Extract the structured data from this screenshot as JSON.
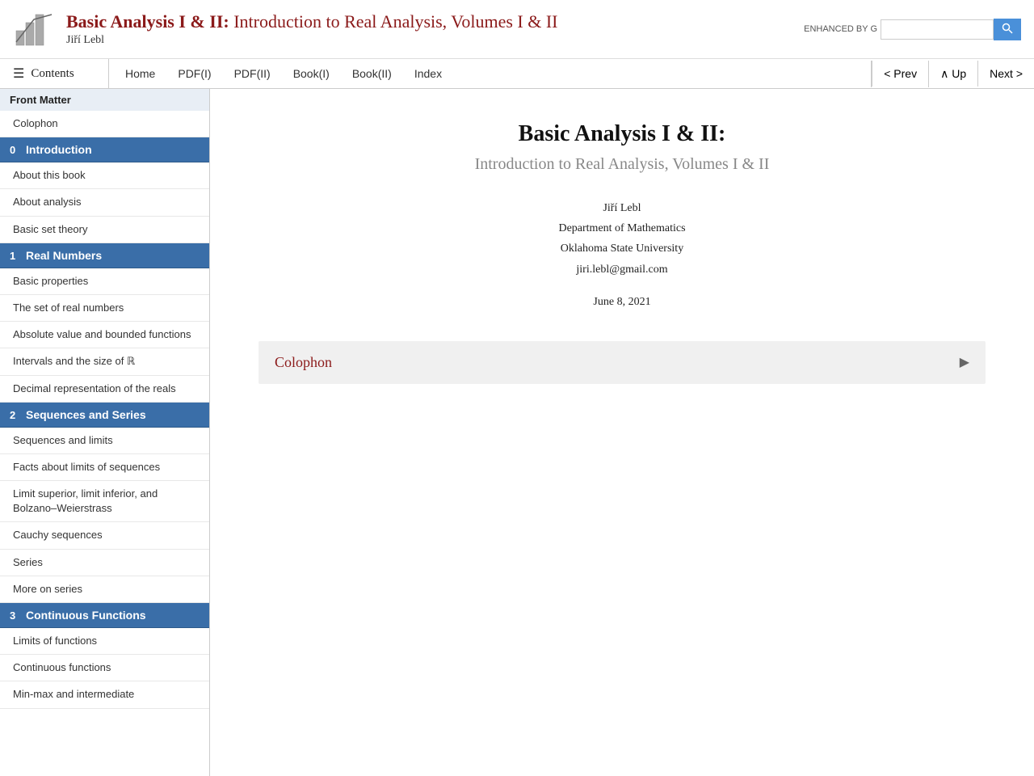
{
  "header": {
    "title_bold": "Basic Analysis I & II:",
    "title_regular": " Introduction to Real Analysis, Volumes I & II",
    "author": "Jiří Lebl",
    "search_label": "ENHANCED BY G",
    "search_placeholder": ""
  },
  "navbar": {
    "contents_label": "Contents",
    "links": [
      {
        "label": "Home",
        "href": "#"
      },
      {
        "label": "PDF(I)",
        "href": "#"
      },
      {
        "label": "PDF(II)",
        "href": "#"
      },
      {
        "label": "Book(I)",
        "href": "#"
      },
      {
        "label": "Book(II)",
        "href": "#"
      },
      {
        "label": "Index",
        "href": "#"
      }
    ],
    "prev_label": "< Prev",
    "up_label": "∧ Up",
    "next_label": "Next >"
  },
  "sidebar": {
    "front_matter_label": "Front Matter",
    "items": [
      {
        "label": "Colophon",
        "type": "item",
        "active": false
      },
      {
        "label": "Introduction",
        "type": "chapter",
        "num": "0",
        "active": true
      },
      {
        "label": "About this book",
        "type": "item",
        "active": false
      },
      {
        "label": "About analysis",
        "type": "item",
        "active": false
      },
      {
        "label": "Basic set theory",
        "type": "item",
        "active": false
      },
      {
        "label": "Real Numbers",
        "type": "chapter",
        "num": "1",
        "active": false
      },
      {
        "label": "Basic properties",
        "type": "item",
        "active": false
      },
      {
        "label": "The set of real numbers",
        "type": "item",
        "active": false
      },
      {
        "label": "Absolute value and bounded functions",
        "type": "item",
        "active": false
      },
      {
        "label": "Intervals and the size of ℝ",
        "type": "item",
        "active": false
      },
      {
        "label": "Decimal representation of the reals",
        "type": "item",
        "active": false
      },
      {
        "label": "Sequences and Series",
        "type": "chapter",
        "num": "2",
        "active": false
      },
      {
        "label": "Sequences and limits",
        "type": "item",
        "active": false
      },
      {
        "label": "Facts about limits of sequences",
        "type": "item",
        "active": false
      },
      {
        "label": "Limit superior, limit inferior, and Bolzano–Weierstrass",
        "type": "item",
        "active": false
      },
      {
        "label": "Cauchy sequences",
        "type": "item",
        "active": false
      },
      {
        "label": "Series",
        "type": "item",
        "active": false
      },
      {
        "label": "More on series",
        "type": "item",
        "active": false
      },
      {
        "label": "Continuous Functions",
        "type": "chapter",
        "num": "3",
        "active": false
      },
      {
        "label": "Limits of functions",
        "type": "item",
        "active": false
      },
      {
        "label": "Continuous functions",
        "type": "item",
        "active": false
      },
      {
        "label": "Min-max and intermediate",
        "type": "item",
        "active": false
      }
    ]
  },
  "main": {
    "book_title": "Basic Analysis I & II:",
    "book_subtitle": "Introduction to Real Analysis, Volumes I & II",
    "author_name": "Jiří Lebl",
    "department": "Department of Mathematics",
    "university": "Oklahoma State University",
    "email": "jiri.lebl@gmail.com",
    "date": "June 8, 2021",
    "colophon_label": "Colophon"
  }
}
